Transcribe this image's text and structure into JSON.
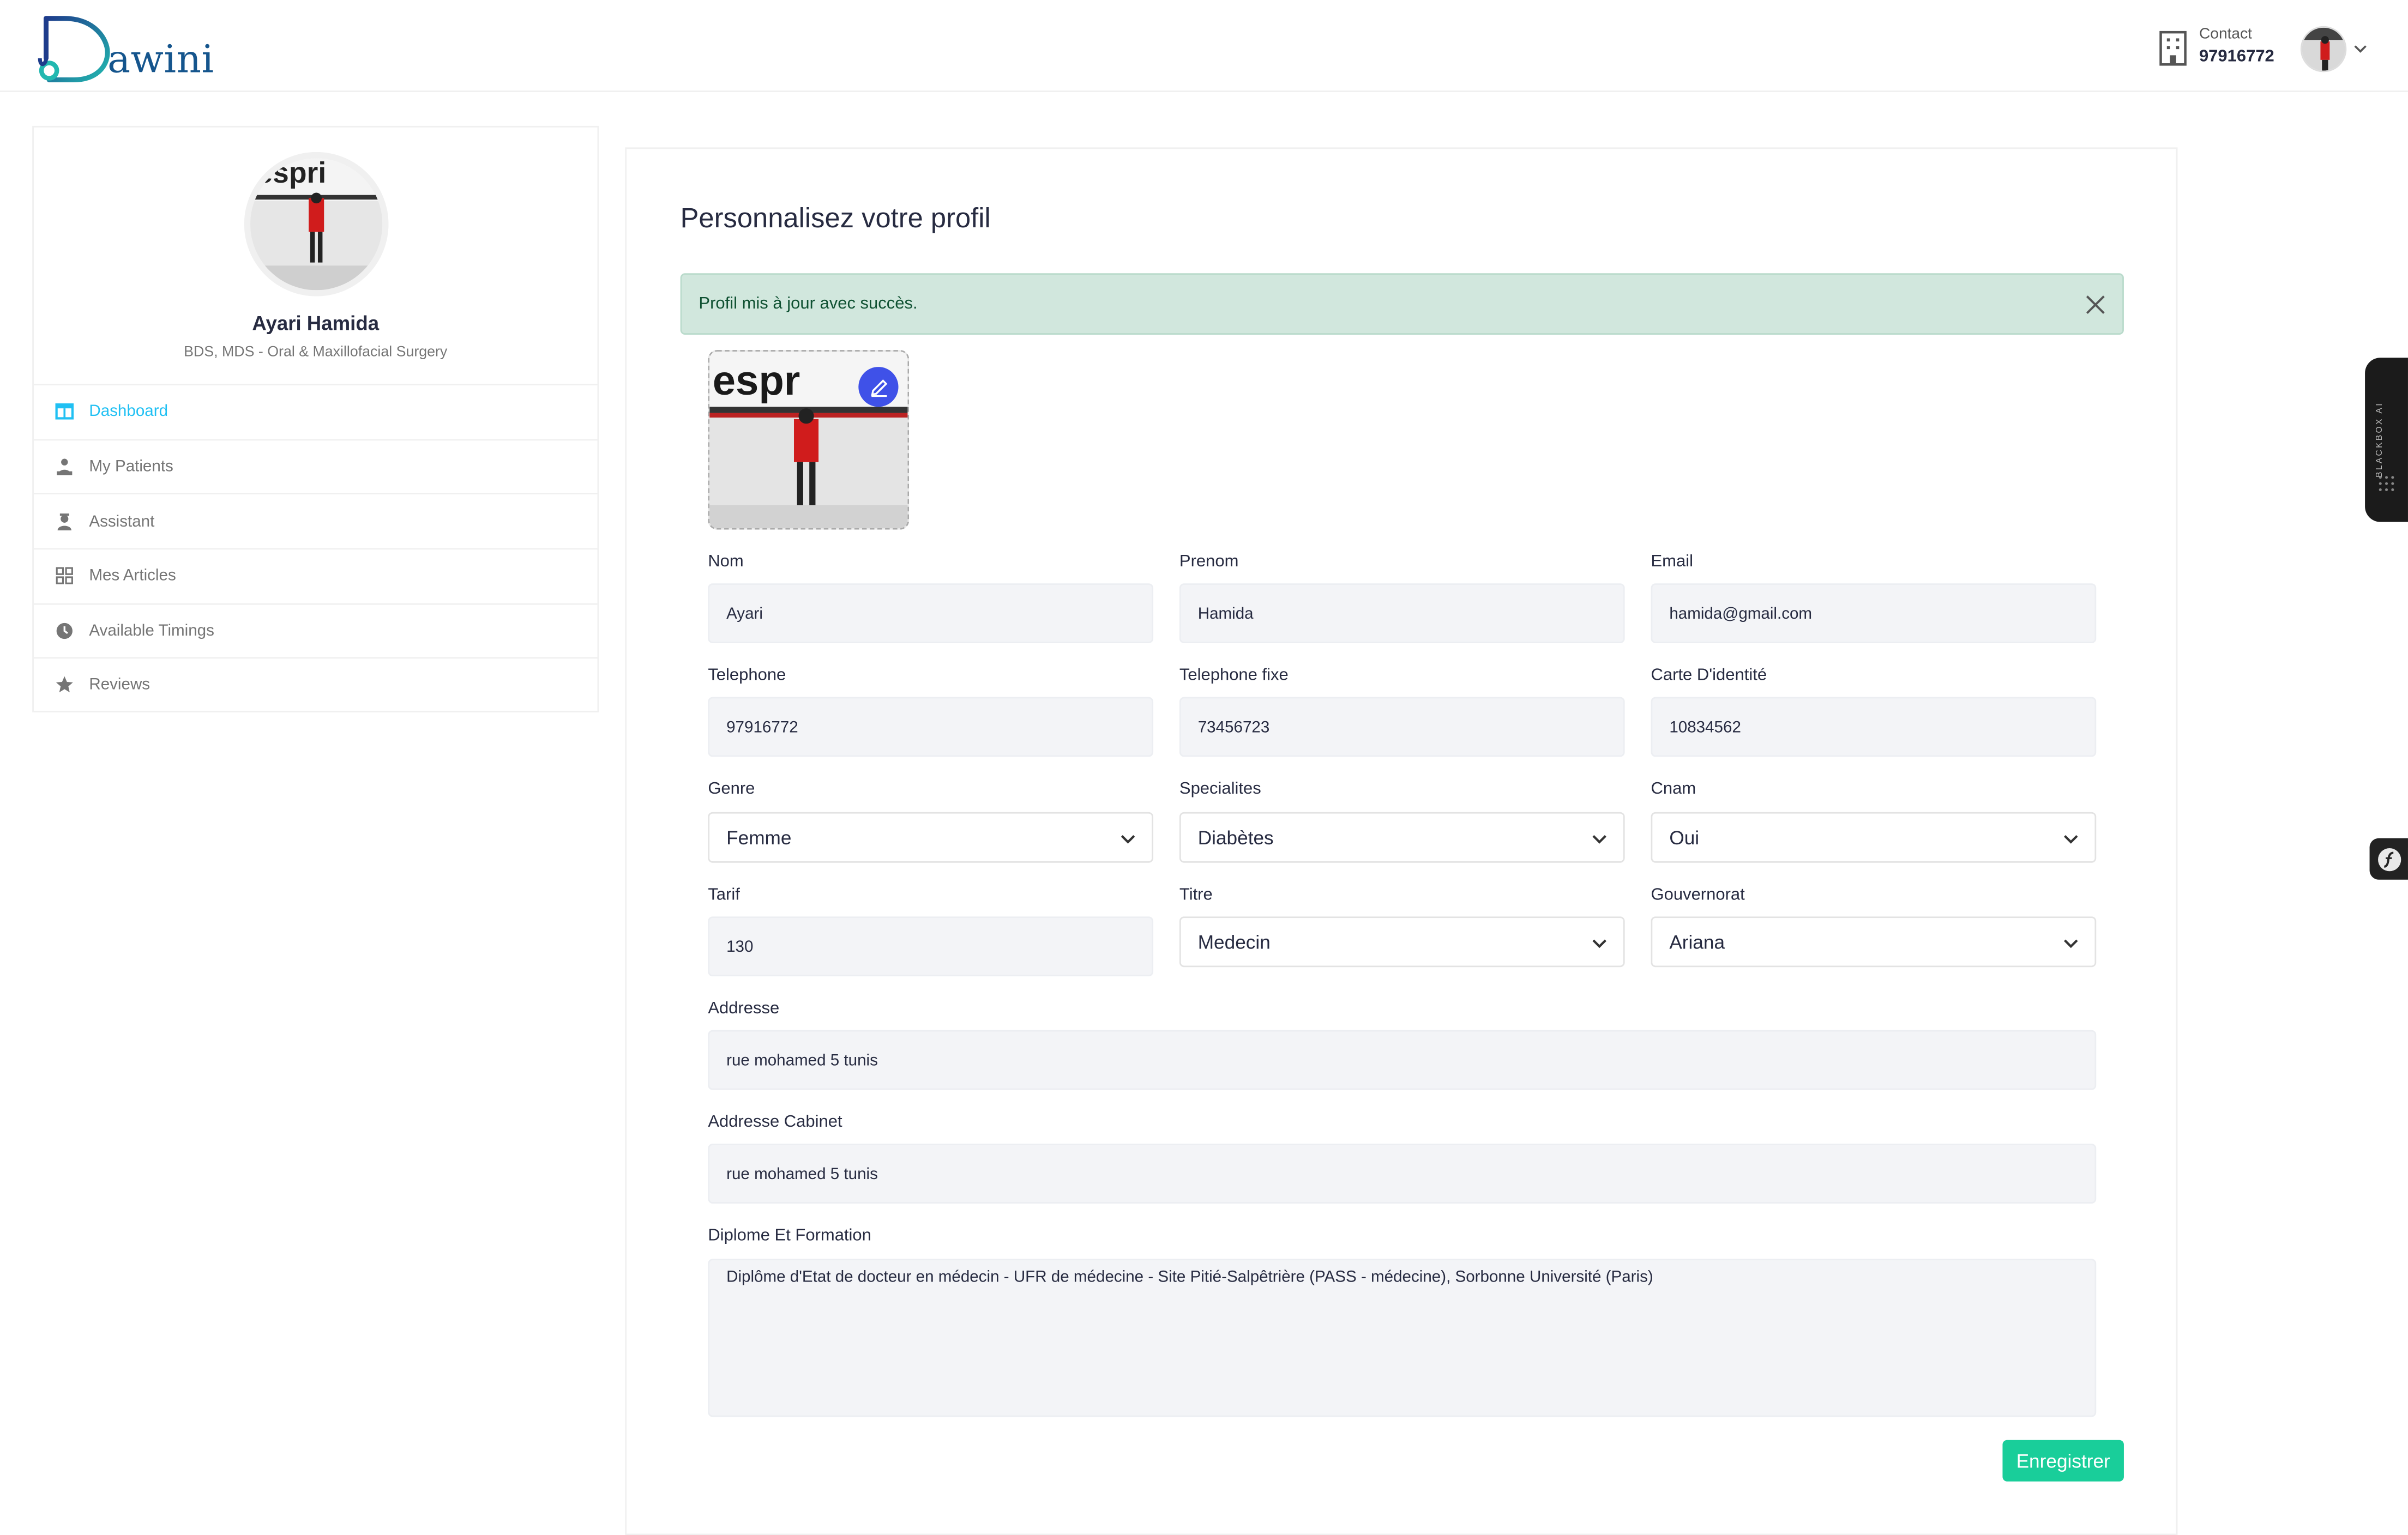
{
  "header": {
    "logo_text": "awini",
    "logo_name": "Dawini",
    "contact_label": "Contact",
    "contact_number": "97916772"
  },
  "sidebar": {
    "doctor_name": "Ayari Hamida",
    "doctor_specialty": "BDS, MDS - Oral & Maxillofacial Surgery",
    "items": [
      {
        "label": "Dashboard",
        "icon": "columns-icon",
        "active": true
      },
      {
        "label": "My Patients",
        "icon": "users-icon",
        "active": false
      },
      {
        "label": "Assistant",
        "icon": "user-nurse-icon",
        "active": false
      },
      {
        "label": "Mes Articles",
        "icon": "grid-icon",
        "active": false
      },
      {
        "label": "Available Timings",
        "icon": "clock-icon",
        "active": false
      },
      {
        "label": "Reviews",
        "icon": "star-icon",
        "active": false
      }
    ]
  },
  "main": {
    "title": "Personnalisez votre profil",
    "alert_message": "Profil mis à jour avec succès.",
    "fields": {
      "nom": {
        "label": "Nom",
        "value": "Ayari"
      },
      "prenom": {
        "label": "Prenom",
        "value": "Hamida"
      },
      "email": {
        "label": "Email",
        "value": "hamida@gmail.com"
      },
      "telephone": {
        "label": "Telephone",
        "value": "97916772"
      },
      "telephone_fixe": {
        "label": "Telephone fixe",
        "value": "73456723"
      },
      "carte": {
        "label": "Carte D'identité",
        "value": "10834562"
      },
      "genre": {
        "label": "Genre",
        "value": "Femme"
      },
      "specialites": {
        "label": "Specialites",
        "value": "Diabètes"
      },
      "cnam": {
        "label": "Cnam",
        "value": "Oui"
      },
      "tarif": {
        "label": "Tarif",
        "value": "130"
      },
      "titre": {
        "label": "Titre",
        "value": "Medecin"
      },
      "gouvernorat": {
        "label": "Gouvernorat",
        "value": "Ariana"
      },
      "addresse": {
        "label": "Addresse",
        "value": "rue mohamed 5 tunis"
      },
      "addresse_cabinet": {
        "label": "Addresse Cabinet",
        "value": "rue mohamed 5 tunis"
      },
      "diplome": {
        "label": "Diplome Et Formation",
        "value": "Diplôme d'Etat de docteur en médecin - UFR de médecine - Site Pitié-Salpêtrière (PASS - médecine), Sorbonne Université (Paris)"
      }
    },
    "save_label": "Enregistrer"
  },
  "widgets": {
    "blackbox_label": "BLACKBOX AI"
  },
  "colors": {
    "accent": "#20c0f3",
    "save_button": "#19ce9a",
    "alert_bg": "#d1e7dd",
    "edit_button": "#3f51e8",
    "logo": "#15558d"
  }
}
